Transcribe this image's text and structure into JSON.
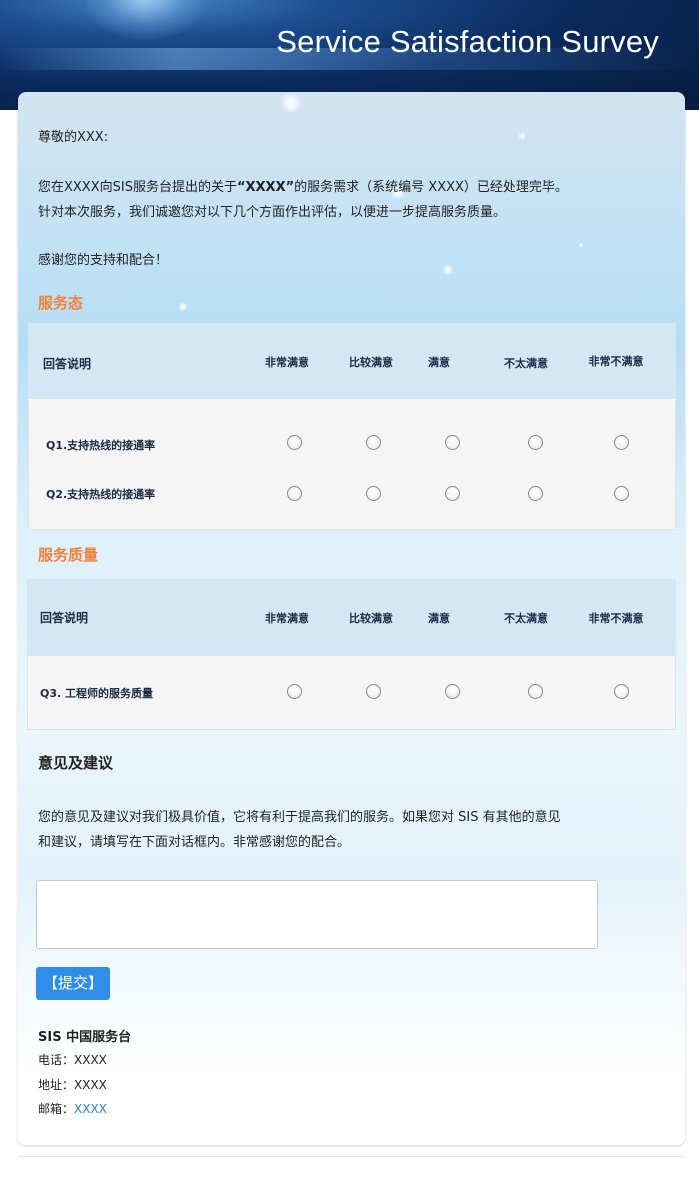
{
  "header": {
    "title": "Service Satisfaction Survey"
  },
  "intro": {
    "greeting": "尊敬的XXX:",
    "line1_pre": "您在XXXX向SIS服务台提出的关于",
    "line1_quote": "“XXXX”",
    "line1_post": "的服务需求（系统编号 XXXX）已经处理完毕。",
    "line2": "针对本次服务，我们诚邀您对以下几个方面作出评估，以便进一步提高服务质量。",
    "thanks": "感谢您的支持和配合！"
  },
  "section1": {
    "title": "服务态",
    "header_label": "回答说明",
    "options": [
      "非常满意",
      "比较满意",
      "满意",
      "不太满意",
      "非常不满意"
    ],
    "questions": [
      "Q1.支持热线的接通率",
      "Q2.支持热线的接通率"
    ]
  },
  "section2": {
    "title": "服务质量",
    "header_label": "回答说明",
    "options": [
      "非常满意",
      "比较满意",
      "满意",
      "不太满意",
      "非常不满意"
    ],
    "questions": [
      "Q3. 工程师的服务质量"
    ]
  },
  "feedback": {
    "title": "意见及建议",
    "line1": "您的意见及建议对我们极具价值，它将有利于提高我们的服务。如果您对 SIS 有其他的意见",
    "line2": "和建议，请填写在下面对话框内。非常感谢您的配合。",
    "textarea_value": "",
    "submit_label": "【提交】"
  },
  "footer": {
    "org": "SIS 中国服务台",
    "phone_label": "电话：",
    "phone_value": "XXXX",
    "address_label": "地址：",
    "address_value": "XXXX",
    "email_label": "邮箱：",
    "email_value": "XXXX"
  },
  "colors": {
    "accent_orange": "#f2813b",
    "button_blue": "#2f8ee9",
    "table_header": "#d2e8f4",
    "link": "#2e7fd6"
  }
}
